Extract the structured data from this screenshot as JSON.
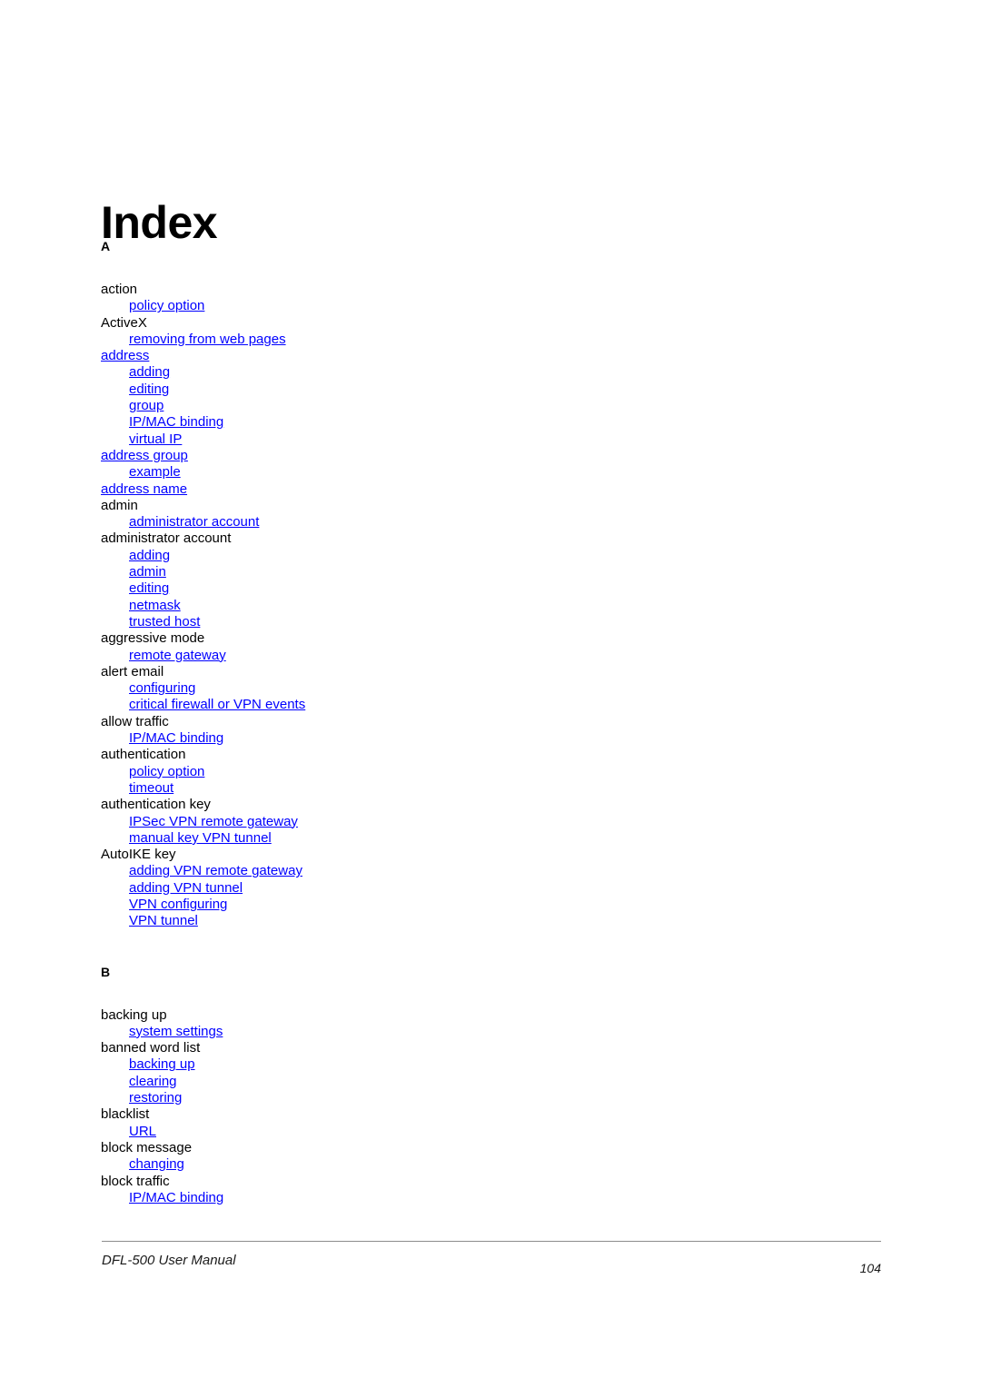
{
  "document": {
    "title": "Index"
  },
  "footer": {
    "manual_name": "DFL-500 User Manual",
    "page_number": "104"
  },
  "colors": {
    "link": "#0000ff",
    "text": "#000000",
    "rule": "#8d8d8d"
  },
  "sections": [
    {
      "letter": "A",
      "entries": [
        {
          "label": "action",
          "level": 1,
          "link": false
        },
        {
          "label": "policy option",
          "level": 2,
          "link": true
        },
        {
          "label": "ActiveX",
          "level": 1,
          "link": false
        },
        {
          "label": "removing from web pages",
          "level": 2,
          "link": true
        },
        {
          "label": "address",
          "level": 1,
          "link": true
        },
        {
          "label": "adding",
          "level": 2,
          "link": true
        },
        {
          "label": "editing",
          "level": 2,
          "link": true
        },
        {
          "label": "group",
          "level": 2,
          "link": true
        },
        {
          "label": "IP/MAC binding",
          "level": 2,
          "link": true
        },
        {
          "label": "virtual IP",
          "level": 2,
          "link": true
        },
        {
          "label": "address group",
          "level": 1,
          "link": true
        },
        {
          "label": "example",
          "level": 2,
          "link": true
        },
        {
          "label": "address name",
          "level": 1,
          "link": true
        },
        {
          "label": "admin",
          "level": 1,
          "link": false
        },
        {
          "label": "administrator account",
          "level": 2,
          "link": true
        },
        {
          "label": "administrator account",
          "level": 1,
          "link": false
        },
        {
          "label": "adding",
          "level": 2,
          "link": true
        },
        {
          "label": "admin",
          "level": 2,
          "link": true
        },
        {
          "label": "editing",
          "level": 2,
          "link": true
        },
        {
          "label": "netmask",
          "level": 2,
          "link": true
        },
        {
          "label": "trusted host",
          "level": 2,
          "link": true
        },
        {
          "label": "aggressive mode",
          "level": 1,
          "link": false
        },
        {
          "label": "remote gateway",
          "level": 2,
          "link": true
        },
        {
          "label": "alert email",
          "level": 1,
          "link": false
        },
        {
          "label": "configuring",
          "level": 2,
          "link": true
        },
        {
          "label": "critical firewall or VPN events",
          "level": 2,
          "link": true
        },
        {
          "label": "allow traffic",
          "level": 1,
          "link": false
        },
        {
          "label": "IP/MAC binding",
          "level": 2,
          "link": true
        },
        {
          "label": "authentication",
          "level": 1,
          "link": false
        },
        {
          "label": "policy option",
          "level": 2,
          "link": true
        },
        {
          "label": "timeout",
          "level": 2,
          "link": true
        },
        {
          "label": "authentication key",
          "level": 1,
          "link": false
        },
        {
          "label": "IPSec VPN remote gateway",
          "level": 2,
          "link": true
        },
        {
          "label": "manual key VPN tunnel",
          "level": 2,
          "link": true
        },
        {
          "label": "AutoIKE key",
          "level": 1,
          "link": false
        },
        {
          "label": "adding VPN remote gateway",
          "level": 2,
          "link": true
        },
        {
          "label": "adding VPN tunnel",
          "level": 2,
          "link": true
        },
        {
          "label": "VPN configuring",
          "level": 2,
          "link": true
        },
        {
          "label": "VPN tunnel",
          "level": 2,
          "link": true
        }
      ]
    },
    {
      "letter": "B",
      "entries": [
        {
          "label": "backing up",
          "level": 1,
          "link": false
        },
        {
          "label": "system settings",
          "level": 2,
          "link": true
        },
        {
          "label": "banned word list",
          "level": 1,
          "link": false
        },
        {
          "label": "backing up",
          "level": 2,
          "link": true
        },
        {
          "label": "clearing",
          "level": 2,
          "link": true
        },
        {
          "label": "restoring",
          "level": 2,
          "link": true
        },
        {
          "label": "blacklist",
          "level": 1,
          "link": false
        },
        {
          "label": "URL",
          "level": 2,
          "link": true
        },
        {
          "label": "block message",
          "level": 1,
          "link": false
        },
        {
          "label": "changing",
          "level": 2,
          "link": true
        },
        {
          "label": "block traffic",
          "level": 1,
          "link": false
        },
        {
          "label": "IP/MAC binding",
          "level": 2,
          "link": true
        }
      ]
    }
  ]
}
